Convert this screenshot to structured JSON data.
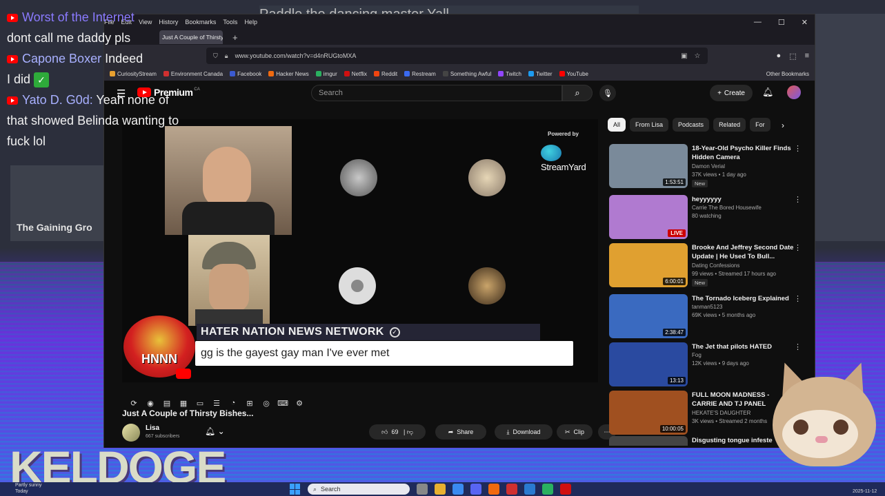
{
  "stream": {
    "top_banner": "Paddle the dancing master Yall",
    "gaining_label": "The Gaining Gro",
    "keldoge": "KELDOGE"
  },
  "chat": [
    {
      "user": "Worst of the Internet",
      "message": "dont call me daddy pls"
    },
    {
      "user": "Capone Boxer",
      "message": "Indeed"
    },
    {
      "user": "",
      "message": "I did"
    },
    {
      "user": "Yato D. G0d:",
      "message": "Yeah none of that showed Belinda wanting to fuck lol"
    }
  ],
  "browser": {
    "menu": [
      "File",
      "Edit",
      "View",
      "History",
      "Bookmarks",
      "Tools",
      "Help"
    ],
    "tab_title": "Just A Couple of Thirsty Bis",
    "url": "www.youtube.com/watch?v=d4nRUGtoMXA",
    "bookmarks": [
      {
        "label": "CuriosityStream",
        "color": "#e8a030"
      },
      {
        "label": "Environment Canada",
        "color": "#d03030"
      },
      {
        "label": "Facebook",
        "color": "#3b5ad0"
      },
      {
        "label": "Hacker News",
        "color": "#f06a10"
      },
      {
        "label": "imgur",
        "color": "#2ab060"
      },
      {
        "label": "Netflix",
        "color": "#d01010"
      },
      {
        "label": "Reddit",
        "color": "#f04510"
      },
      {
        "label": "Restream",
        "color": "#3a6af0"
      },
      {
        "label": "Something Awful",
        "color": "#444444"
      },
      {
        "label": "Twitch",
        "color": "#9146ff"
      },
      {
        "label": "Twitter",
        "color": "#1d9bf0"
      },
      {
        "label": "YouTube",
        "color": "#ff0000"
      }
    ],
    "other_bookmarks": "Other Bookmarks"
  },
  "youtube": {
    "logo_text": "Premium",
    "logo_sup": "CA",
    "search_placeholder": "Search",
    "create_label": "Create",
    "video": {
      "powered_by": "Powered by",
      "streamyard": "StreamYard",
      "hnnn_badge": "HNNN",
      "network_title": "HATER NATION NEWS NETWORK",
      "message": "gg is the gayest gay man I've ever met"
    },
    "title": "Just A Couple of Thirsty Bishes...",
    "channel": {
      "name": "Lisa",
      "subscribers": "667 subscribers"
    },
    "actions": {
      "likes": "69",
      "share": "Share",
      "download": "Download",
      "clip": "Clip"
    },
    "chips": [
      "All",
      "From Lisa",
      "Podcasts",
      "Related",
      "For"
    ],
    "recommendations": [
      {
        "title": "18-Year-Old Psycho Killer Finds Hidden Camera",
        "channel": "Damon Verial",
        "meta": "37K views • 1 day ago",
        "duration": "1:53:51",
        "badge": "New",
        "thumb": "#7a8a9a"
      },
      {
        "title": "heyyyyyy",
        "channel": "Carrie The Bored Housewife",
        "meta": "80 watching",
        "duration": "LIVE",
        "badge": "",
        "thumb": "#b07ad0"
      },
      {
        "title": "Brooke And Jeffrey Second Date Update | He Used To Bull...",
        "channel": "Dating Confessions",
        "meta": "99 views • Streamed 17 hours ago",
        "duration": "6:00:01",
        "badge": "New",
        "thumb": "#e0a030"
      },
      {
        "title": "The Tornado Iceberg Explained",
        "channel": "tanman5123",
        "meta": "69K views • 5 months ago",
        "duration": "2:38:47",
        "badge": "",
        "thumb": "#3a6ac0"
      },
      {
        "title": "The Jet that pilots HATED",
        "channel": "Fog",
        "meta": "12K views • 9 days ago",
        "duration": "13:13",
        "badge": "",
        "thumb": "#2a4aa0"
      },
      {
        "title": "FULL MOON MADNESS - CARRIE AND TJ PANEL",
        "channel": "HEKATE'S DAUGHTER",
        "meta": "3K views • Streamed 2 months",
        "duration": "10:00:05",
        "badge": "",
        "thumb": "#a05020"
      },
      {
        "title": "Disgusting tongue infeste",
        "channel": "",
        "meta": "",
        "duration": "",
        "badge": "",
        "thumb": "#444444"
      }
    ]
  },
  "taskbar": {
    "weather": "Partly sunny",
    "weather_sub": "Today",
    "search_placeholder": "Search",
    "clock": "2025-11-12"
  }
}
